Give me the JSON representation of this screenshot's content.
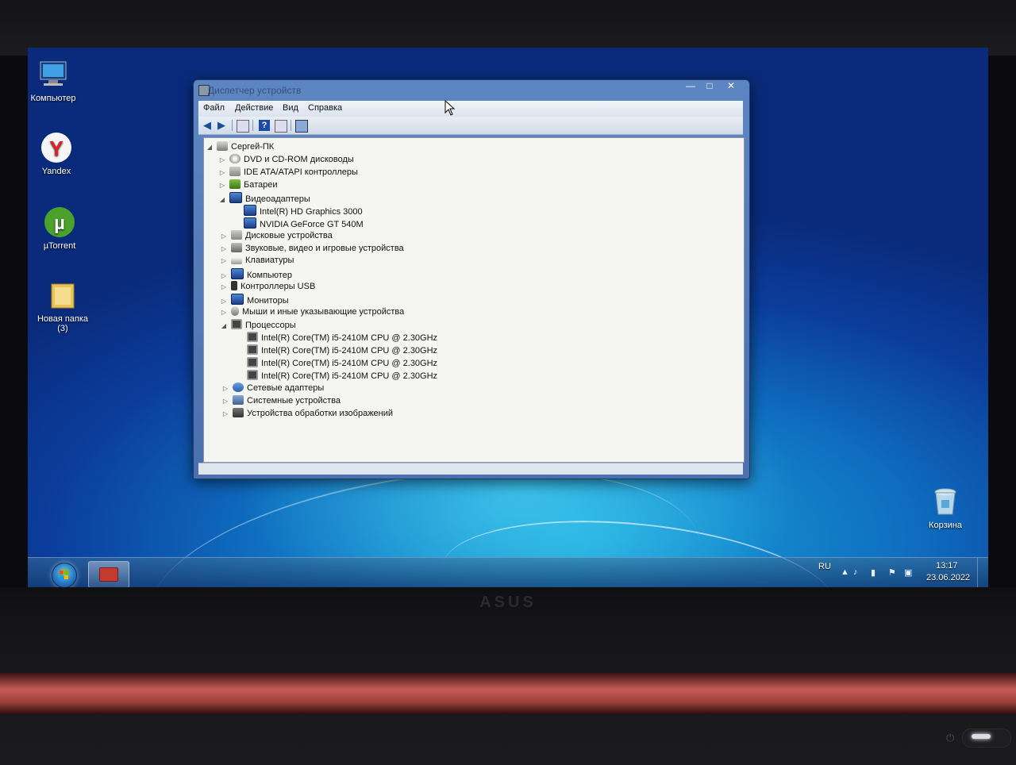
{
  "desktop": {
    "icons": [
      {
        "label": "Компьютер"
      },
      {
        "label": "Yandex"
      },
      {
        "label": "µTorrent"
      },
      {
        "label": "Новая папка (3)"
      },
      {
        "label": "Корзина"
      }
    ]
  },
  "window": {
    "title": "Диспетчер устройств",
    "controls": {
      "minimize": "—",
      "maximize": "□",
      "close": "✕"
    },
    "menu": [
      "Файл",
      "Действие",
      "Вид",
      "Справка"
    ],
    "toolbar_icons": [
      "back-icon",
      "forward-icon",
      "properties-icon",
      "help-icon",
      "view-icon",
      "scan-hardware-icon"
    ],
    "tree": {
      "root": "Сергей-ПК",
      "nodes": [
        {
          "label": "DVD и CD-ROM дисководы",
          "expanded": false
        },
        {
          "label": "IDE ATA/ATAPI контроллеры",
          "expanded": false
        },
        {
          "label": "Батареи",
          "expanded": false
        },
        {
          "label": "Видеоадаптеры",
          "expanded": true,
          "children": [
            "Intel(R) HD Graphics 3000",
            "NVIDIA GeForce GT 540M"
          ]
        },
        {
          "label": "Дисковые устройства",
          "expanded": false
        },
        {
          "label": "Звуковые, видео и игровые устройства",
          "expanded": false
        },
        {
          "label": "Клавиатуры",
          "expanded": false
        },
        {
          "label": "Компьютер",
          "expanded": false
        },
        {
          "label": "Контроллеры USB",
          "expanded": false
        },
        {
          "label": "Мониторы",
          "expanded": false
        },
        {
          "label": "Мыши и иные указывающие устройства",
          "expanded": false
        },
        {
          "label": "Процессоры",
          "expanded": true,
          "children": [
            "Intel(R) Core(TM) i5-2410M CPU @ 2.30GHz",
            "Intel(R) Core(TM) i5-2410M CPU @ 2.30GHz",
            "Intel(R) Core(TM) i5-2410M CPU @ 2.30GHz",
            "Intel(R) Core(TM) i5-2410M CPU @ 2.30GHz"
          ]
        },
        {
          "label": "Сетевые адаптеры",
          "expanded": false
        },
        {
          "label": "Системные устройства",
          "expanded": false
        },
        {
          "label": "Устройства обработки изображений",
          "expanded": false
        }
      ]
    }
  },
  "taskbar": {
    "language": "RU",
    "time": "13:17",
    "date": "23.06.2022"
  },
  "hardware": {
    "brand": "ASUS"
  }
}
